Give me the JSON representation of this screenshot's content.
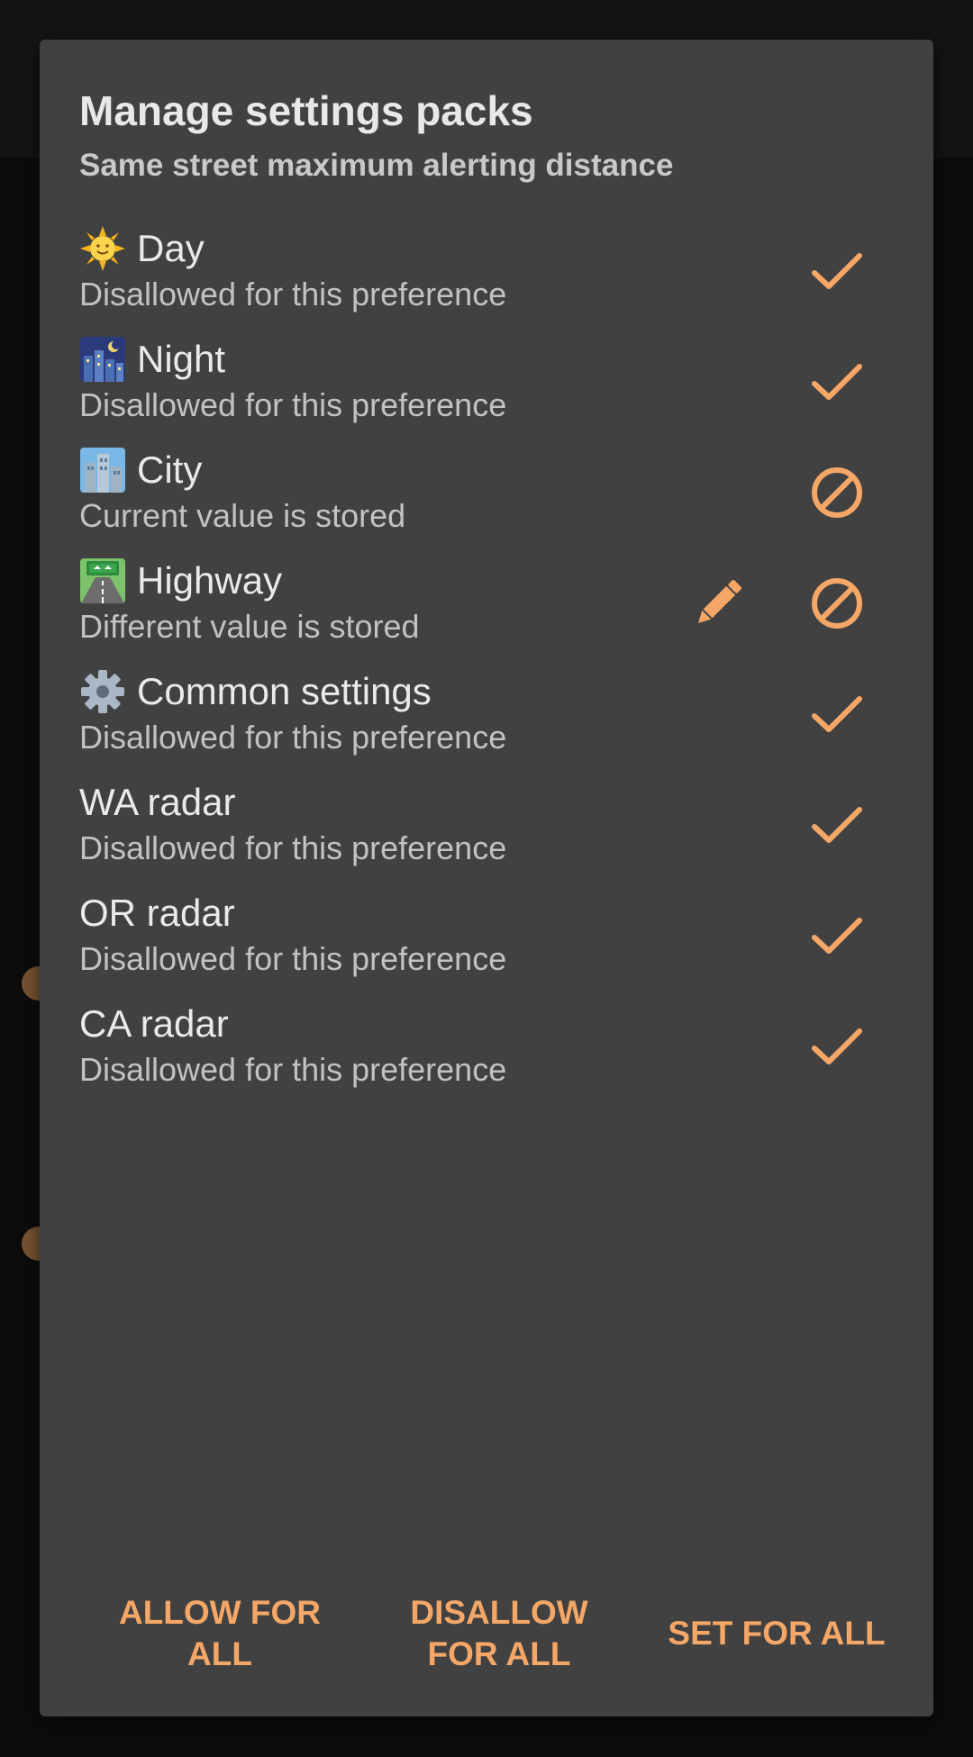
{
  "dialog": {
    "title": "Manage settings packs",
    "subtitle": "Same street maximum alerting distance"
  },
  "packs": [
    {
      "emoji": "sun-face-icon",
      "name": "Day",
      "status": "Disallowed for this preference",
      "state": "check",
      "editable": false
    },
    {
      "emoji": "night-city-icon",
      "name": "Night",
      "status": "Disallowed for this preference",
      "state": "check",
      "editable": false
    },
    {
      "emoji": "cityscape-icon",
      "name": "City",
      "status": "Current value is stored",
      "state": "blocked",
      "editable": false
    },
    {
      "emoji": "highway-icon",
      "name": "Highway",
      "status": "Different value is stored",
      "state": "blocked",
      "editable": true
    },
    {
      "emoji": "gear-icon",
      "name": "Common settings",
      "status": "Disallowed for this preference",
      "state": "check",
      "editable": false
    },
    {
      "emoji": null,
      "name": "WA radar",
      "status": "Disallowed for this preference",
      "state": "check",
      "editable": false
    },
    {
      "emoji": null,
      "name": "OR radar",
      "status": "Disallowed for this preference",
      "state": "check",
      "editable": false
    },
    {
      "emoji": null,
      "name": "CA radar",
      "status": "Disallowed for this preference",
      "state": "check",
      "editable": false
    }
  ],
  "actions": {
    "allow_all_line1": "ALLOW FOR",
    "allow_all_line2": "ALL",
    "disallow_all_line1": "DISALLOW",
    "disallow_all_line2": "FOR ALL",
    "set_all": "SET FOR ALL"
  },
  "colors": {
    "accent": "#f4a766",
    "dialog_bg": "#414141",
    "backdrop": "#0c0c0c"
  }
}
